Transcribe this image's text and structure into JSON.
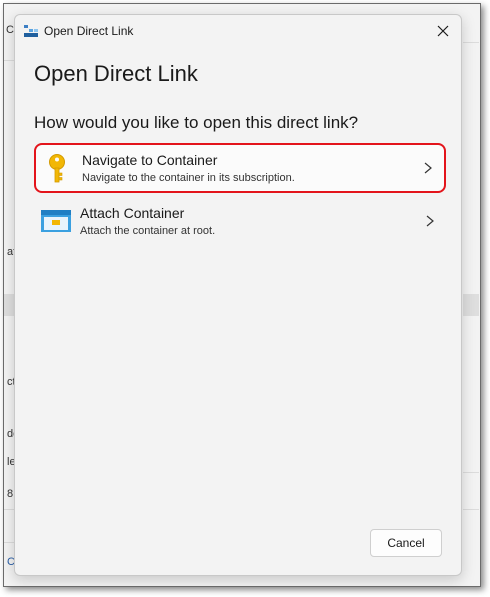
{
  "background_window": {
    "fragments": [
      "Cu",
      "at",
      "ct",
      "de",
      "le",
      "8",
      "C"
    ]
  },
  "dialog": {
    "window_title": "Open Direct Link",
    "heading": "Open Direct Link",
    "prompt": "How would you like to open this direct link?",
    "options": [
      {
        "title": "Navigate to Container",
        "description": "Navigate to the container in its subscription.",
        "icon": "key-icon",
        "selected": true
      },
      {
        "title": "Attach Container",
        "description": "Attach the container at root.",
        "icon": "container-icon",
        "selected": false
      }
    ],
    "cancel_label": "Cancel"
  },
  "colors": {
    "selection_border": "#e3141b",
    "key_gold": "#f2b705",
    "container_blue": "#3aa0e0"
  }
}
